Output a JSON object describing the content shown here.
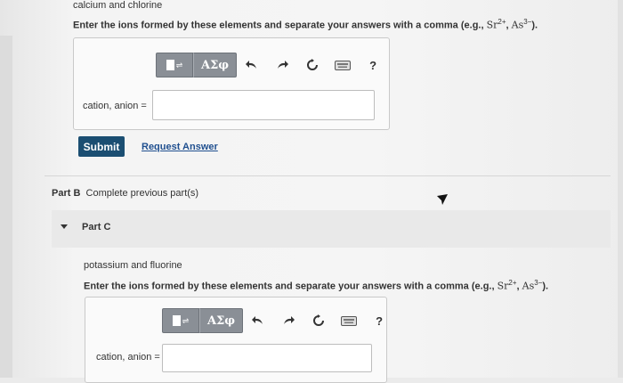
{
  "top": {
    "element_pair": "calcium and chlorine",
    "instruction_prefix": "Enter the ions formed by these elements and separate your answers with a comma (e.g., ",
    "example_sr": "Sr",
    "example_sr_charge": "2+",
    "example_sep": ", ",
    "example_as": "As",
    "example_as_charge": "3−",
    "instruction_suffix": ").",
    "toolbar": {
      "greek_label": "ΑΣφ",
      "help_label": "?"
    },
    "field_label": "cation, anion =",
    "field_value": "",
    "submit_label": "Submit",
    "request_label": "Request Answer"
  },
  "part_b": {
    "label": "Part B",
    "status": "Complete previous part(s)"
  },
  "part_c": {
    "label": "Part C",
    "element_pair": "potassium and fluorine",
    "instruction_prefix": "Enter the ions formed by these elements and separate your answers with a comma (e.g., ",
    "example_sr": "Sr",
    "example_sr_charge": "2+",
    "example_sep": ", ",
    "example_as": "As",
    "example_as_charge": "3−",
    "instruction_suffix": ").",
    "toolbar": {
      "greek_label": "ΑΣφ",
      "help_label": "?"
    },
    "field_label": "cation, anion =",
    "field_value": ""
  },
  "colors": {
    "submit_bg": "#1b4e72",
    "link": "#1f4f8f",
    "toolbar_gray": "#8a8f96"
  }
}
